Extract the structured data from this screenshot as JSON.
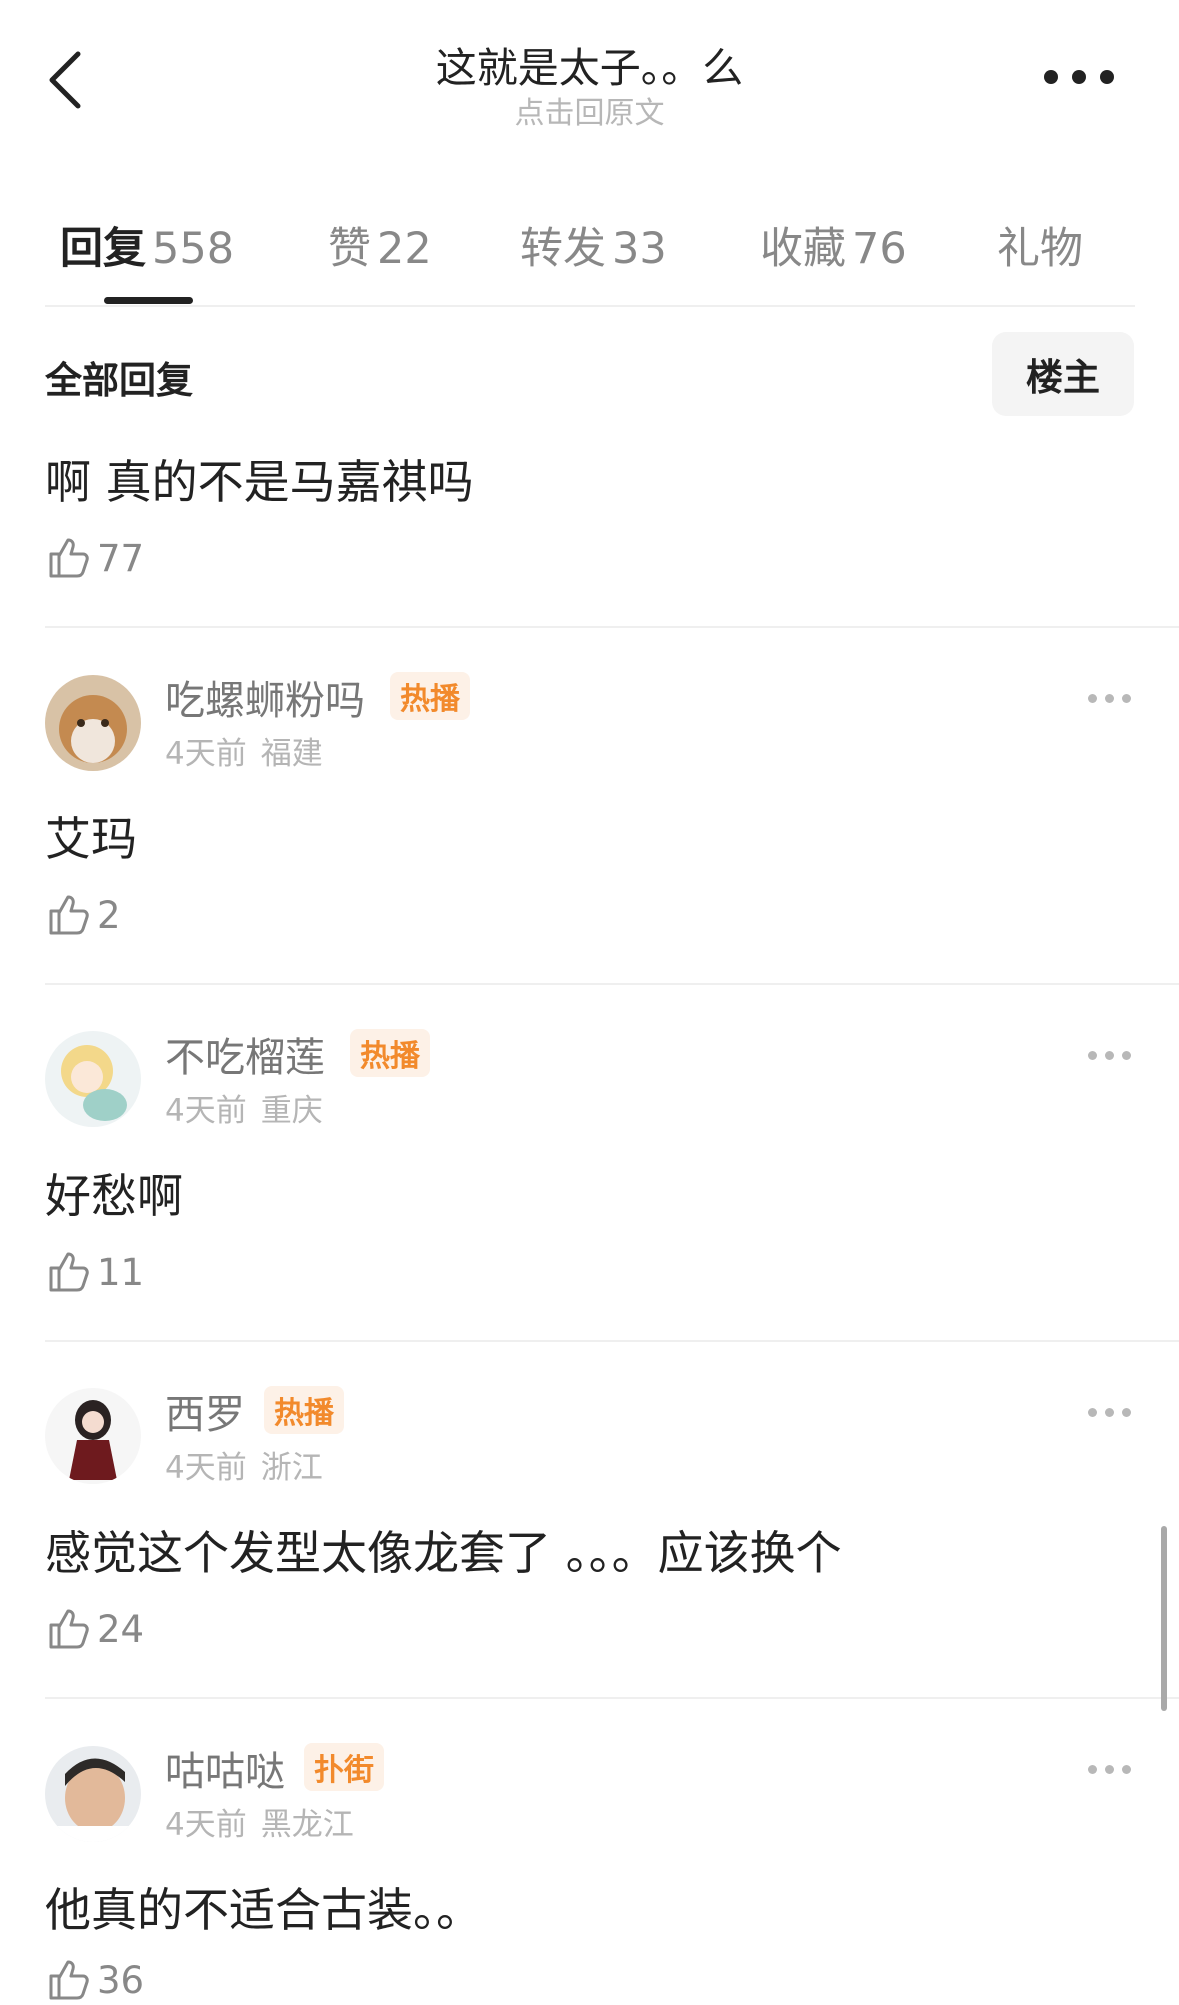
{
  "header": {
    "title": "这就是太子。。么",
    "subtitle": "点击回原文"
  },
  "tabs": [
    {
      "label": "回复",
      "count": "558"
    },
    {
      "label": "赞",
      "count": "22"
    },
    {
      "label": "转发",
      "count": "33"
    },
    {
      "label": "收藏",
      "count": "76"
    },
    {
      "label": "礼物",
      "count": ""
    }
  ],
  "section": {
    "title": "全部回复",
    "op_filter_label": "楼主"
  },
  "comments": [
    {
      "text": "啊 真的不是马嘉祺吗",
      "likes": "77"
    },
    {
      "username": "吃螺蛳粉吗",
      "badge": "热播",
      "time": "4天前",
      "location": "福建",
      "text": "艾玛",
      "likes": "2",
      "avatar": "cat-avatar"
    },
    {
      "username": "不吃榴莲",
      "badge": "热播",
      "time": "4天前",
      "location": "重庆",
      "text": "好愁啊",
      "likes": "11",
      "avatar": "anime-avatar"
    },
    {
      "username": "西罗",
      "badge": "热播",
      "time": "4天前",
      "location": "浙江",
      "text": "感觉这个发型太像龙套了 。。。应该换个",
      "likes": "24",
      "avatar": "character-avatar"
    },
    {
      "username": "咕咕哒",
      "badge": "扑街",
      "time": "4天前",
      "location": "黑龙江",
      "text": "他真的不适合古装。。",
      "likes": "36",
      "avatar": "face-avatar"
    }
  ],
  "colors": {
    "badge_text": "#f28a2c",
    "badge_bg": "#fdf1e7",
    "muted": "#888888"
  }
}
